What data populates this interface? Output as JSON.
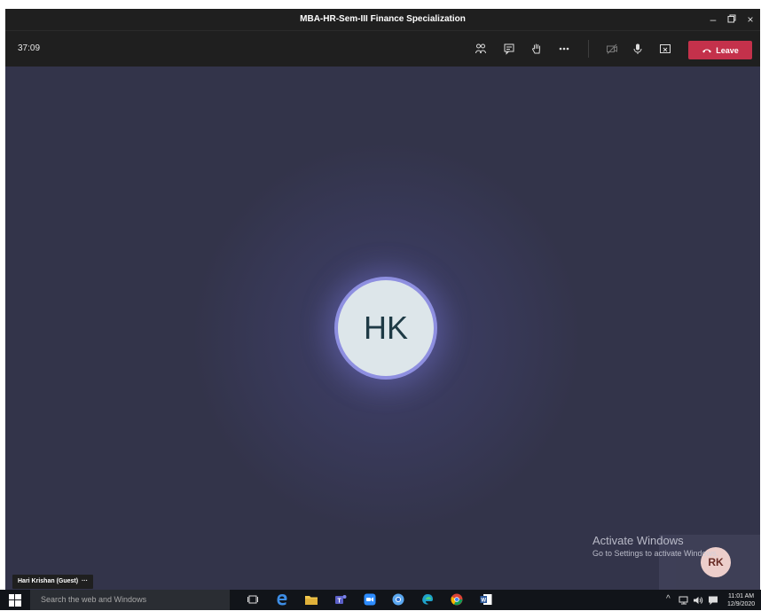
{
  "window": {
    "title": "MBA-HR-Sem-III Finance Specialization"
  },
  "toolbar": {
    "timer": "37:09",
    "leave_label": "Leave"
  },
  "participant": {
    "initials": "HK",
    "name_label": "Hari Krishan (Guest)"
  },
  "self_view": {
    "initials": "RK"
  },
  "watermark": {
    "line1": "Activate Windows",
    "line2": "Go to Settings to activate Windows."
  },
  "taskbar": {
    "search_placeholder": "Search the web and Windows",
    "time": "11:01 AM",
    "date": "12/9/2020"
  },
  "colors": {
    "stage": "#33344a",
    "leave": "#c4314b",
    "avatar_ring": "#8e8fe0",
    "avatar_fill": "#dde6ea",
    "self_avatar": "#f8d7d2"
  }
}
